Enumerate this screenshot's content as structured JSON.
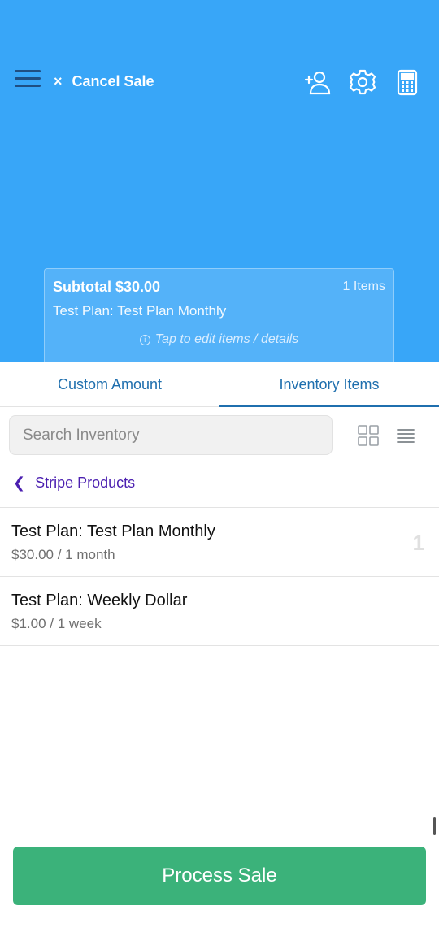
{
  "header": {
    "cancel_icon": "×",
    "cancel_label": "Cancel Sale",
    "icons": [
      "menu-icon",
      "add-customer-icon",
      "gear-icon",
      "calculator-icon"
    ],
    "background_color": "#38a6f8"
  },
  "subtotal": {
    "label": "Subtotal $30.00",
    "count": "1 Items",
    "plan": "Test Plan: Test Plan Monthly",
    "hint": "Tap to edit items / details"
  },
  "tabs": [
    {
      "label": "Custom Amount",
      "active": false
    },
    {
      "label": "Inventory Items",
      "active": true
    }
  ],
  "search": {
    "placeholder": "Search Inventory",
    "value": ""
  },
  "breadcrumb": {
    "label": "Stripe Products"
  },
  "items": [
    {
      "name": "Test Plan: Test Plan Monthly",
      "price": "$30.00 / 1 month",
      "qty": "1"
    },
    {
      "name": "Test Plan: Weekly Dollar",
      "price": "$1.00 / 1 week",
      "qty": ""
    }
  ],
  "footer": {
    "process_label": "Process Sale",
    "button_color": "#3bb27a"
  }
}
